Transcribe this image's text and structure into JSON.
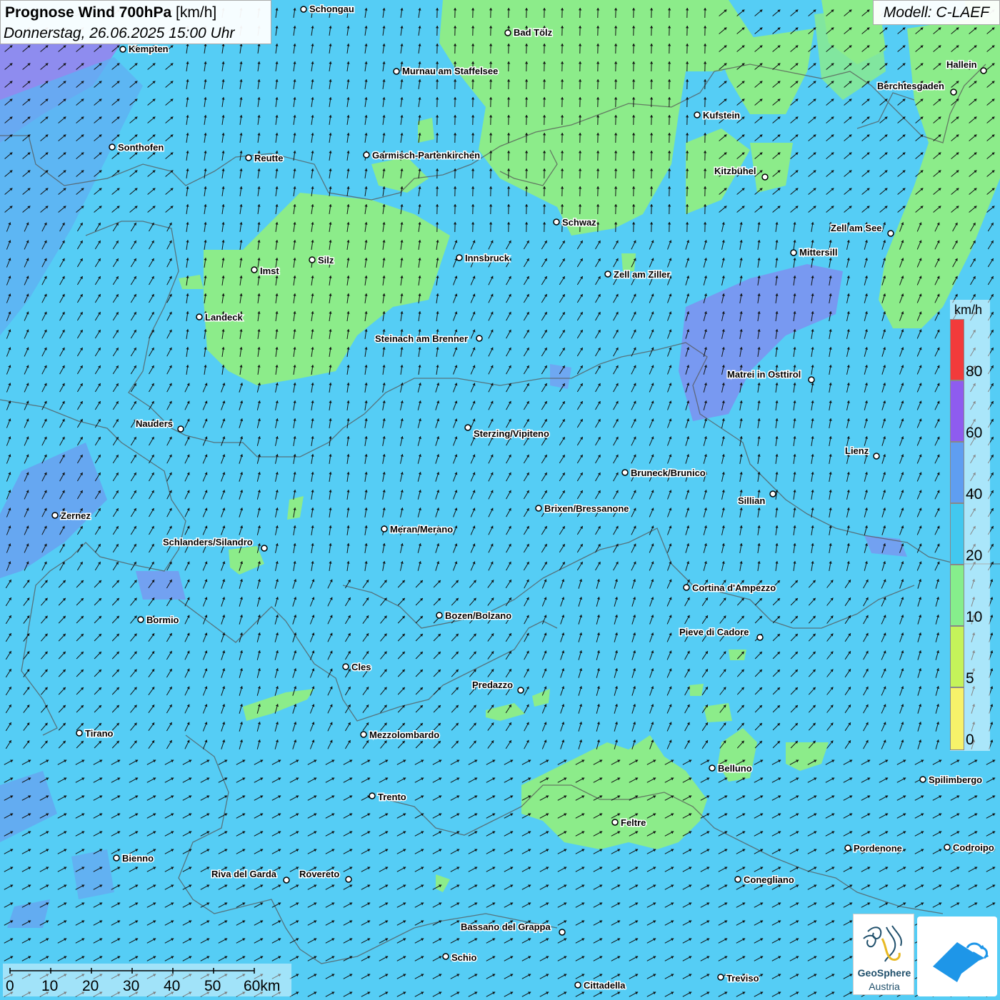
{
  "header": {
    "title_bold": "Prognose Wind 700hPa",
    "title_unit": "[km/h]",
    "subtitle": "Donnerstag, 26.06.2025 15:00 Uhr",
    "model": "Modell: C-LAEF"
  },
  "legend": {
    "unit": "km/h",
    "classes": [
      {
        "label": "80",
        "color": "#f23b3b"
      },
      {
        "label": "60",
        "color": "#8e5cef"
      },
      {
        "label": "40",
        "color": "#5f9ef1"
      },
      {
        "label": "20",
        "color": "#42c8ef"
      },
      {
        "label": "10",
        "color": "#86ee8c"
      },
      {
        "label": "5",
        "color": "#c5f35a"
      },
      {
        "label": "0",
        "color": "#f7f26a"
      }
    ]
  },
  "scale": {
    "labels": [
      "0",
      "10",
      "20",
      "30",
      "40",
      "50",
      "60km"
    ]
  },
  "cities": [
    {
      "name": "Schongau"
    },
    {
      "name": "Bad Tölz"
    },
    {
      "name": "Kempten"
    },
    {
      "name": "Murnau am Staffelsee"
    },
    {
      "name": "Hallein"
    },
    {
      "name": "Berchtesgaden"
    },
    {
      "name": "Kufstein"
    },
    {
      "name": "Sonthofen"
    },
    {
      "name": "Reutte"
    },
    {
      "name": "Garmisch-Partenkirchen"
    },
    {
      "name": "Kitzbühel"
    },
    {
      "name": "Schwaz"
    },
    {
      "name": "Zell am See"
    },
    {
      "name": "Mittersill"
    },
    {
      "name": "Innsbruck"
    },
    {
      "name": "Silz"
    },
    {
      "name": "Imst"
    },
    {
      "name": "Zell am Ziller"
    },
    {
      "name": "Landeck"
    },
    {
      "name": "Steinach am Brenner"
    },
    {
      "name": "Matrei in Osttirol"
    },
    {
      "name": "Nauders"
    },
    {
      "name": "Sterzing/Vipiteno"
    },
    {
      "name": "Lienz"
    },
    {
      "name": "Bruneck/Brunico"
    },
    {
      "name": "Sillian"
    },
    {
      "name": "Zernez"
    },
    {
      "name": "Brixen/Bressanone"
    },
    {
      "name": "Meran/Merano"
    },
    {
      "name": "Schlanders/Silandro"
    },
    {
      "name": "Cortina d'Ampezzo"
    },
    {
      "name": "Bormio"
    },
    {
      "name": "Bozen/Bolzano"
    },
    {
      "name": "Pieve di Cadore"
    },
    {
      "name": "Cles"
    },
    {
      "name": "Predazzo"
    },
    {
      "name": "Tirano"
    },
    {
      "name": "Mezzolombardo"
    },
    {
      "name": "Belluno"
    },
    {
      "name": "Spilimbergo"
    },
    {
      "name": "Trento"
    },
    {
      "name": "Feltre"
    },
    {
      "name": "Pordenone"
    },
    {
      "name": "Codroipo"
    },
    {
      "name": "Bienno"
    },
    {
      "name": "Riva del Garda"
    },
    {
      "name": "Rovereto"
    },
    {
      "name": "Conegliano"
    },
    {
      "name": "Bassano del Grappa"
    },
    {
      "name": "Schio"
    },
    {
      "name": "Treviso"
    },
    {
      "name": "Cittadella"
    }
  ],
  "logo": {
    "name_line1": "GeoSphere",
    "name_line2": "Austria"
  }
}
